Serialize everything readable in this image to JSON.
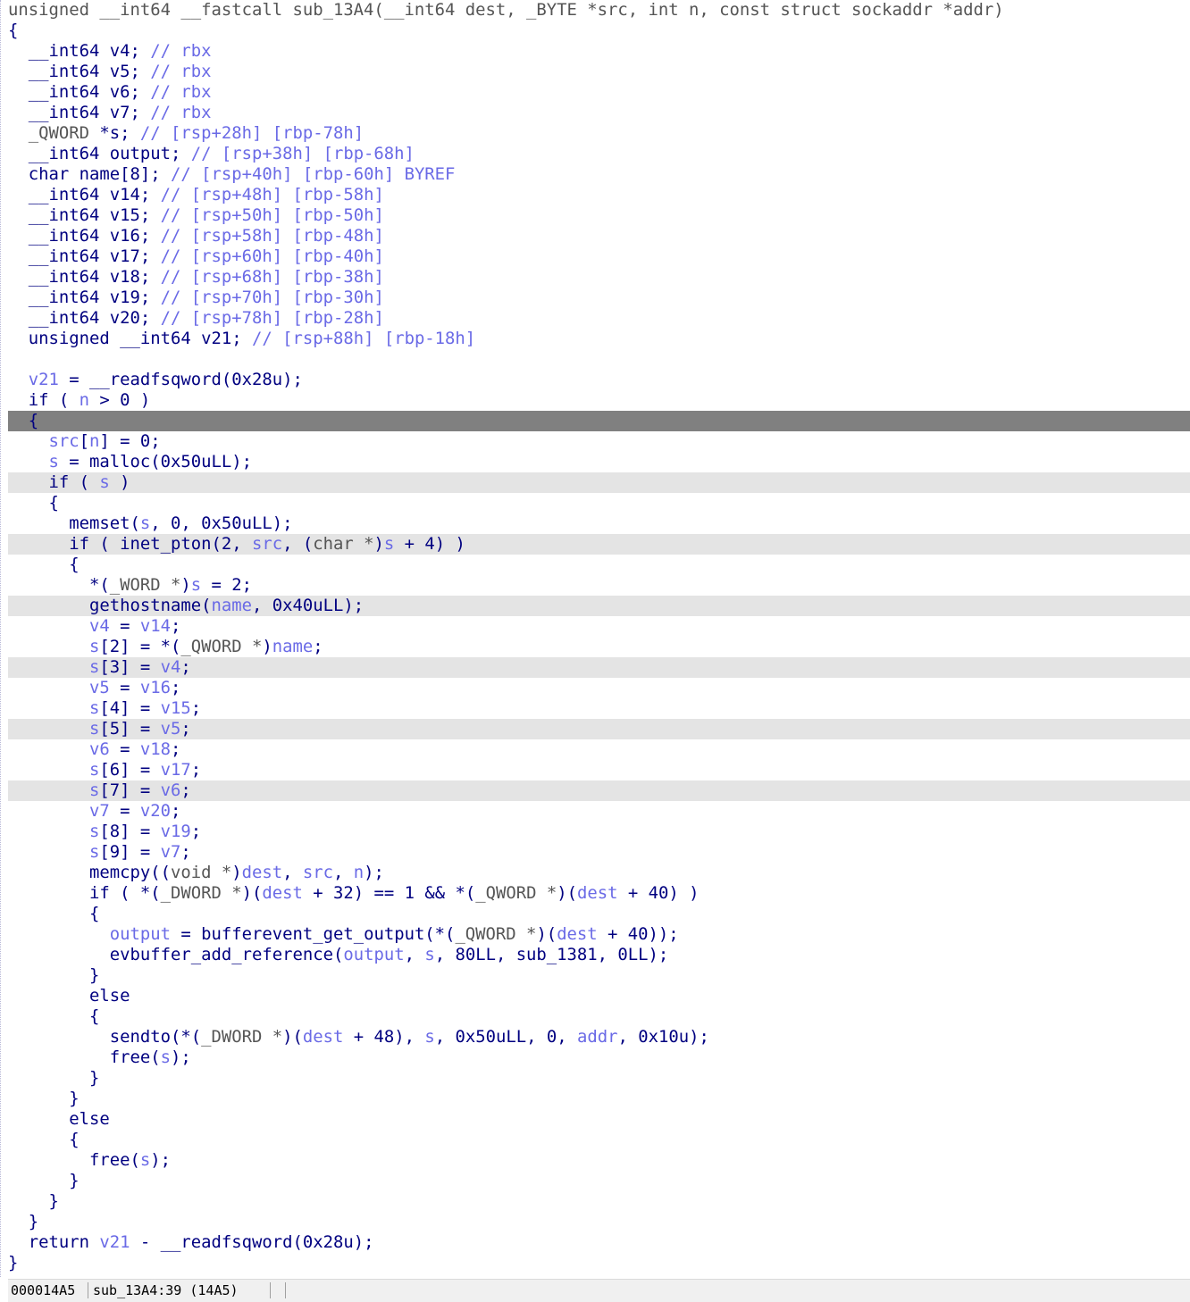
{
  "code_lines": [
    {
      "tokens": [
        [
          "unsigned __int64 __fastcall sub_13A4(",
          "typ"
        ],
        [
          "__int64 dest, _BYTE *src, int n, const struct sockaddr *addr)",
          "typ"
        ]
      ],
      "hl": "none"
    },
    {
      "tokens": [
        [
          "{",
          "kw"
        ]
      ],
      "hl": "none"
    },
    {
      "tokens": [
        [
          "  __int64 v4; ",
          "kw"
        ],
        [
          "// rbx",
          "cmt"
        ]
      ],
      "hl": "none"
    },
    {
      "tokens": [
        [
          "  __int64 v5; ",
          "kw"
        ],
        [
          "// rbx",
          "cmt"
        ]
      ],
      "hl": "none"
    },
    {
      "tokens": [
        [
          "  __int64 v6; ",
          "kw"
        ],
        [
          "// rbx",
          "cmt"
        ]
      ],
      "hl": "none"
    },
    {
      "tokens": [
        [
          "  __int64 v7; ",
          "kw"
        ],
        [
          "// rbx",
          "cmt"
        ]
      ],
      "hl": "none"
    },
    {
      "tokens": [
        [
          "  _QWORD ",
          "typ"
        ],
        [
          "*s; ",
          "kw"
        ],
        [
          "// [rsp+28h] [rbp-78h]",
          "cmt"
        ]
      ],
      "hl": "none"
    },
    {
      "tokens": [
        [
          "  __int64 output; ",
          "kw"
        ],
        [
          "// [rsp+38h] [rbp-68h]",
          "cmt"
        ]
      ],
      "hl": "none"
    },
    {
      "tokens": [
        [
          "  char name[8]; ",
          "kw"
        ],
        [
          "// [rsp+40h] [rbp-60h] BYREF",
          "cmt"
        ]
      ],
      "hl": "none"
    },
    {
      "tokens": [
        [
          "  __int64 v14; ",
          "kw"
        ],
        [
          "// [rsp+48h] [rbp-58h]",
          "cmt"
        ]
      ],
      "hl": "none"
    },
    {
      "tokens": [
        [
          "  __int64 v15; ",
          "kw"
        ],
        [
          "// [rsp+50h] [rbp-50h]",
          "cmt"
        ]
      ],
      "hl": "none"
    },
    {
      "tokens": [
        [
          "  __int64 v16; ",
          "kw"
        ],
        [
          "// [rsp+58h] [rbp-48h]",
          "cmt"
        ]
      ],
      "hl": "none"
    },
    {
      "tokens": [
        [
          "  __int64 v17; ",
          "kw"
        ],
        [
          "// [rsp+60h] [rbp-40h]",
          "cmt"
        ]
      ],
      "hl": "none"
    },
    {
      "tokens": [
        [
          "  __int64 v18; ",
          "kw"
        ],
        [
          "// [rsp+68h] [rbp-38h]",
          "cmt"
        ]
      ],
      "hl": "none"
    },
    {
      "tokens": [
        [
          "  __int64 v19; ",
          "kw"
        ],
        [
          "// [rsp+70h] [rbp-30h]",
          "cmt"
        ]
      ],
      "hl": "none"
    },
    {
      "tokens": [
        [
          "  __int64 v20; ",
          "kw"
        ],
        [
          "// [rsp+78h] [rbp-28h]",
          "cmt"
        ]
      ],
      "hl": "none"
    },
    {
      "tokens": [
        [
          "  unsigned __int64 v21; ",
          "kw"
        ],
        [
          "// [rsp+88h] [rbp-18h]",
          "cmt"
        ]
      ],
      "hl": "none"
    },
    {
      "tokens": [
        [
          "",
          "kw"
        ]
      ],
      "hl": "none"
    },
    {
      "tokens": [
        [
          "  ",
          "kw"
        ],
        [
          "v21",
          "var"
        ],
        [
          " = __readfsqword(0x28u);",
          "kw"
        ]
      ],
      "hl": "none"
    },
    {
      "tokens": [
        [
          "  if ( ",
          "kw"
        ],
        [
          "n",
          "var"
        ],
        [
          " > 0 )",
          "kw"
        ]
      ],
      "hl": "none"
    },
    {
      "tokens": [
        [
          "  {",
          "kw"
        ]
      ],
      "hl": "cur"
    },
    {
      "tokens": [
        [
          "    ",
          "kw"
        ],
        [
          "src",
          "var"
        ],
        [
          "[",
          "kw"
        ],
        [
          "n",
          "var"
        ],
        [
          "] = 0;",
          "kw"
        ]
      ],
      "hl": "none"
    },
    {
      "tokens": [
        [
          "    ",
          "kw"
        ],
        [
          "s",
          "var"
        ],
        [
          " = malloc(0x50uLL);",
          "kw"
        ]
      ],
      "hl": "none"
    },
    {
      "tokens": [
        [
          "    if ( ",
          "kw"
        ],
        [
          "s",
          "var"
        ],
        [
          " )",
          "kw"
        ]
      ],
      "hl": "hl"
    },
    {
      "tokens": [
        [
          "    {",
          "kw"
        ]
      ],
      "hl": "none"
    },
    {
      "tokens": [
        [
          "      memset(",
          "kw"
        ],
        [
          "s",
          "var"
        ],
        [
          ", 0, 0x50uLL);",
          "kw"
        ]
      ],
      "hl": "none"
    },
    {
      "tokens": [
        [
          "      if ( inet_pton(2, ",
          "kw"
        ],
        [
          "src",
          "var"
        ],
        [
          ", (",
          "kw"
        ],
        [
          "char *",
          "typ"
        ],
        [
          ")",
          "kw"
        ],
        [
          "s",
          "var"
        ],
        [
          " + 4) )",
          "kw"
        ]
      ],
      "hl": "hl"
    },
    {
      "tokens": [
        [
          "      {",
          "kw"
        ]
      ],
      "hl": "none"
    },
    {
      "tokens": [
        [
          "        *(",
          "kw"
        ],
        [
          "_WORD *",
          "typ"
        ],
        [
          ")",
          "kw"
        ],
        [
          "s",
          "var"
        ],
        [
          " = 2;",
          "kw"
        ]
      ],
      "hl": "none"
    },
    {
      "tokens": [
        [
          "        gethostname(",
          "kw"
        ],
        [
          "name",
          "var"
        ],
        [
          ", 0x40uLL);",
          "kw"
        ]
      ],
      "hl": "hl"
    },
    {
      "tokens": [
        [
          "        ",
          "kw"
        ],
        [
          "v4",
          "var"
        ],
        [
          " = ",
          "kw"
        ],
        [
          "v14",
          "var"
        ],
        [
          ";",
          "kw"
        ]
      ],
      "hl": "none"
    },
    {
      "tokens": [
        [
          "        ",
          "kw"
        ],
        [
          "s",
          "var"
        ],
        [
          "[2] = *(",
          "kw"
        ],
        [
          "_QWORD *",
          "typ"
        ],
        [
          ")",
          "kw"
        ],
        [
          "name",
          "var"
        ],
        [
          ";",
          "kw"
        ]
      ],
      "hl": "none"
    },
    {
      "tokens": [
        [
          "        ",
          "kw"
        ],
        [
          "s",
          "var"
        ],
        [
          "[3] = ",
          "kw"
        ],
        [
          "v4",
          "var"
        ],
        [
          ";",
          "kw"
        ]
      ],
      "hl": "hl"
    },
    {
      "tokens": [
        [
          "        ",
          "kw"
        ],
        [
          "v5",
          "var"
        ],
        [
          " = ",
          "kw"
        ],
        [
          "v16",
          "var"
        ],
        [
          ";",
          "kw"
        ]
      ],
      "hl": "none"
    },
    {
      "tokens": [
        [
          "        ",
          "kw"
        ],
        [
          "s",
          "var"
        ],
        [
          "[4] = ",
          "kw"
        ],
        [
          "v15",
          "var"
        ],
        [
          ";",
          "kw"
        ]
      ],
      "hl": "none"
    },
    {
      "tokens": [
        [
          "        ",
          "kw"
        ],
        [
          "s",
          "var"
        ],
        [
          "[5] = ",
          "kw"
        ],
        [
          "v5",
          "var"
        ],
        [
          ";",
          "kw"
        ]
      ],
      "hl": "hl"
    },
    {
      "tokens": [
        [
          "        ",
          "kw"
        ],
        [
          "v6",
          "var"
        ],
        [
          " = ",
          "kw"
        ],
        [
          "v18",
          "var"
        ],
        [
          ";",
          "kw"
        ]
      ],
      "hl": "none"
    },
    {
      "tokens": [
        [
          "        ",
          "kw"
        ],
        [
          "s",
          "var"
        ],
        [
          "[6] = ",
          "kw"
        ],
        [
          "v17",
          "var"
        ],
        [
          ";",
          "kw"
        ]
      ],
      "hl": "none"
    },
    {
      "tokens": [
        [
          "        ",
          "kw"
        ],
        [
          "s",
          "var"
        ],
        [
          "[7] = ",
          "kw"
        ],
        [
          "v6",
          "var"
        ],
        [
          ";",
          "kw"
        ]
      ],
      "hl": "hl"
    },
    {
      "tokens": [
        [
          "        ",
          "kw"
        ],
        [
          "v7",
          "var"
        ],
        [
          " = ",
          "kw"
        ],
        [
          "v20",
          "var"
        ],
        [
          ";",
          "kw"
        ]
      ],
      "hl": "none"
    },
    {
      "tokens": [
        [
          "        ",
          "kw"
        ],
        [
          "s",
          "var"
        ],
        [
          "[8] = ",
          "kw"
        ],
        [
          "v19",
          "var"
        ],
        [
          ";",
          "kw"
        ]
      ],
      "hl": "none"
    },
    {
      "tokens": [
        [
          "        ",
          "kw"
        ],
        [
          "s",
          "var"
        ],
        [
          "[9] = ",
          "kw"
        ],
        [
          "v7",
          "var"
        ],
        [
          ";",
          "kw"
        ]
      ],
      "hl": "none"
    },
    {
      "tokens": [
        [
          "        memcpy((",
          "kw"
        ],
        [
          "void *",
          "typ"
        ],
        [
          ")",
          "kw"
        ],
        [
          "dest",
          "var"
        ],
        [
          ", ",
          "kw"
        ],
        [
          "src",
          "var"
        ],
        [
          ", ",
          "kw"
        ],
        [
          "n",
          "var"
        ],
        [
          ");",
          "kw"
        ]
      ],
      "hl": "none"
    },
    {
      "tokens": [
        [
          "        if ( *(",
          "kw"
        ],
        [
          "_DWORD *",
          "typ"
        ],
        [
          ")(",
          "kw"
        ],
        [
          "dest",
          "var"
        ],
        [
          " + 32) == 1 && *(",
          "kw"
        ],
        [
          "_QWORD *",
          "typ"
        ],
        [
          ")(",
          "kw"
        ],
        [
          "dest",
          "var"
        ],
        [
          " + 40) )",
          "kw"
        ]
      ],
      "hl": "none"
    },
    {
      "tokens": [
        [
          "        {",
          "kw"
        ]
      ],
      "hl": "none"
    },
    {
      "tokens": [
        [
          "          ",
          "kw"
        ],
        [
          "output",
          "var"
        ],
        [
          " = bufferevent_get_output(*(",
          "kw"
        ],
        [
          "_QWORD *",
          "typ"
        ],
        [
          ")(",
          "kw"
        ],
        [
          "dest",
          "var"
        ],
        [
          " + 40));",
          "kw"
        ]
      ],
      "hl": "none"
    },
    {
      "tokens": [
        [
          "          evbuffer_add_reference(",
          "kw"
        ],
        [
          "output",
          "var"
        ],
        [
          ", ",
          "kw"
        ],
        [
          "s",
          "var"
        ],
        [
          ", 80LL, sub_1381, 0LL);",
          "kw"
        ]
      ],
      "hl": "none"
    },
    {
      "tokens": [
        [
          "        }",
          "kw"
        ]
      ],
      "hl": "none"
    },
    {
      "tokens": [
        [
          "        else",
          "kw"
        ]
      ],
      "hl": "none"
    },
    {
      "tokens": [
        [
          "        {",
          "kw"
        ]
      ],
      "hl": "none"
    },
    {
      "tokens": [
        [
          "          sendto(*(",
          "kw"
        ],
        [
          "_DWORD *",
          "typ"
        ],
        [
          ")(",
          "kw"
        ],
        [
          "dest",
          "var"
        ],
        [
          " + 48), ",
          "kw"
        ],
        [
          "s",
          "var"
        ],
        [
          ", 0x50uLL, 0, ",
          "kw"
        ],
        [
          "addr",
          "var"
        ],
        [
          ", 0x10u);",
          "kw"
        ]
      ],
      "hl": "none"
    },
    {
      "tokens": [
        [
          "          free(",
          "kw"
        ],
        [
          "s",
          "var"
        ],
        [
          ");",
          "kw"
        ]
      ],
      "hl": "none"
    },
    {
      "tokens": [
        [
          "        }",
          "kw"
        ]
      ],
      "hl": "none"
    },
    {
      "tokens": [
        [
          "      }",
          "kw"
        ]
      ],
      "hl": "none"
    },
    {
      "tokens": [
        [
          "      else",
          "kw"
        ]
      ],
      "hl": "none"
    },
    {
      "tokens": [
        [
          "      {",
          "kw"
        ]
      ],
      "hl": "none"
    },
    {
      "tokens": [
        [
          "        free(",
          "kw"
        ],
        [
          "s",
          "var"
        ],
        [
          ");",
          "kw"
        ]
      ],
      "hl": "none"
    },
    {
      "tokens": [
        [
          "      }",
          "kw"
        ]
      ],
      "hl": "none"
    },
    {
      "tokens": [
        [
          "    }",
          "kw"
        ]
      ],
      "hl": "none"
    },
    {
      "tokens": [
        [
          "  }",
          "kw"
        ]
      ],
      "hl": "none"
    },
    {
      "tokens": [
        [
          "  return ",
          "kw"
        ],
        [
          "v21",
          "var"
        ],
        [
          " - __readfsqword(0x28u);",
          "kw"
        ]
      ],
      "hl": "none"
    },
    {
      "tokens": [
        [
          "}",
          "kw"
        ]
      ],
      "hl": "none"
    }
  ],
  "statusbar": {
    "address": "000014A5",
    "location": "sub_13A4:39 (14A5)"
  },
  "colors": {
    "keyword": "#000080",
    "variable": "#6a6ae6",
    "comment": "#6a6ae6",
    "type": "#555555",
    "current_line": "#808080",
    "highlight_line": "#e4e4e4"
  }
}
